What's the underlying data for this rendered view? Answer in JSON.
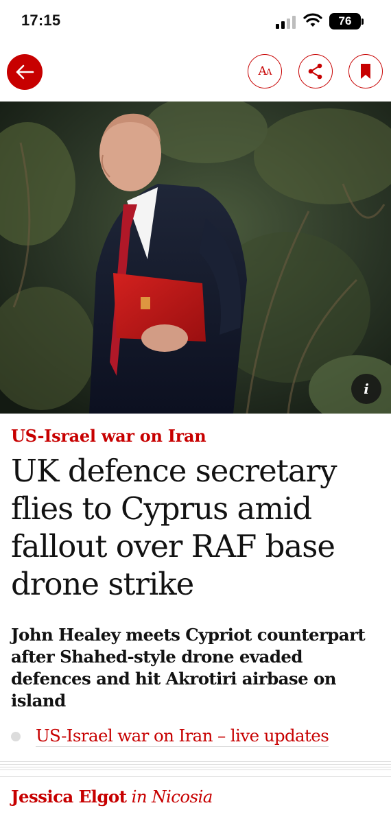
{
  "status_bar": {
    "time": "17:15",
    "battery": "76"
  },
  "toolbar": {
    "text_size_glyph_large": "A",
    "text_size_glyph_small": "A"
  },
  "hero": {
    "info_label": "i"
  },
  "article": {
    "kicker": "US-Israel war on Iran",
    "headline": "UK defence secretary flies to Cyprus amid fallout over RAF base drone strike",
    "standfirst": "John Healey meets Cypriot counterpart after Shahed-style drone evaded defences and hit Akrotiri airbase on island",
    "related_link": "US-Israel war on Iran – live updates",
    "byline": {
      "author": "Jessica Elgot",
      "location": "in Nicosia"
    }
  },
  "colors": {
    "accent": "#c70000",
    "text": "#121212",
    "divider": "#dcdcdc"
  }
}
